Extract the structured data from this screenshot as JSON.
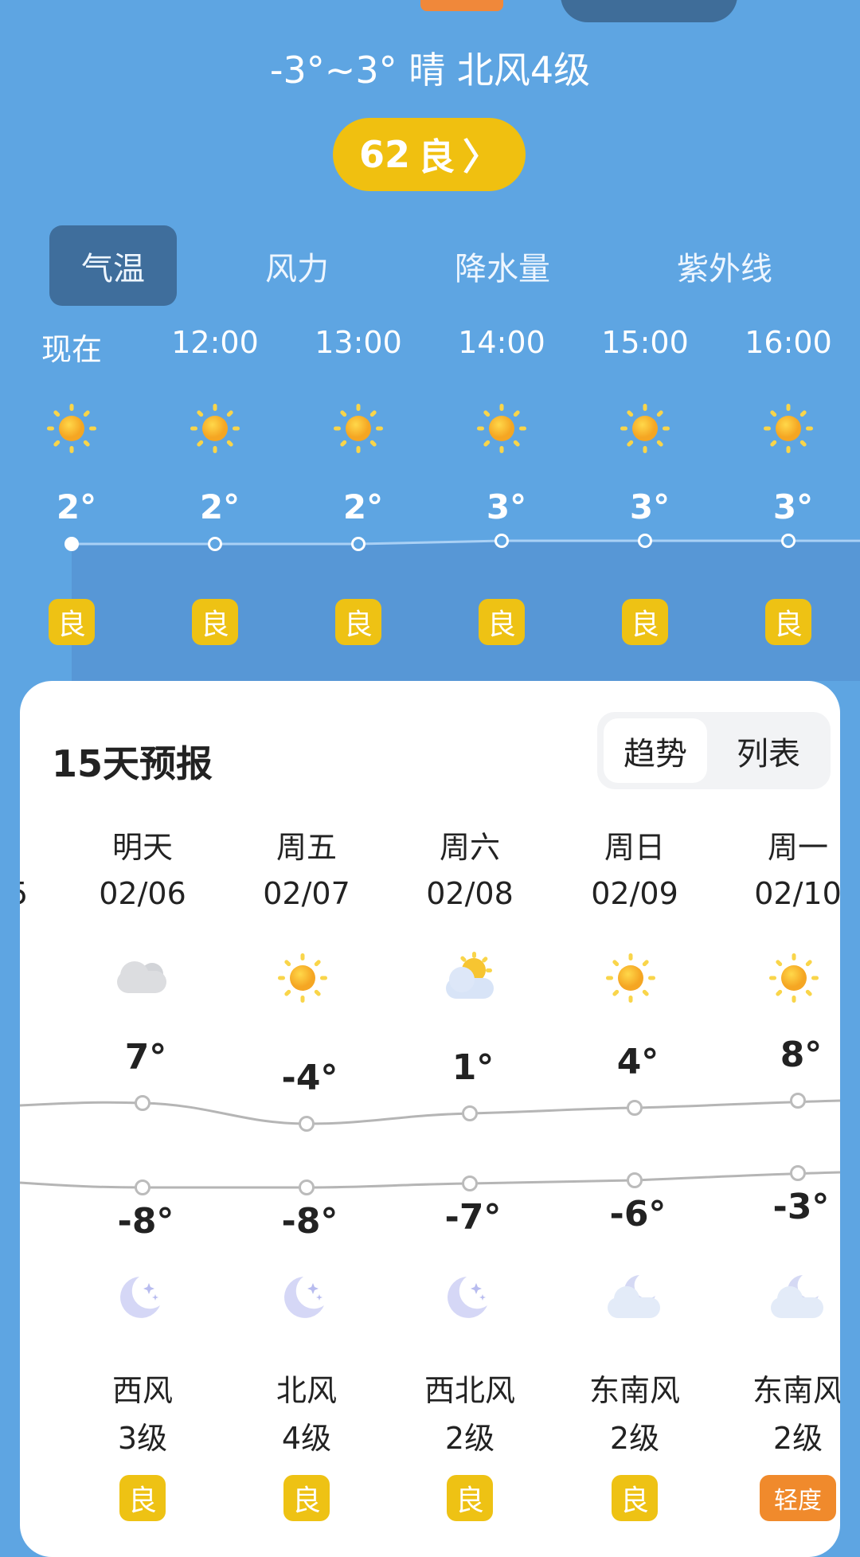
{
  "summary": "-3°~3° 晴 北风4级",
  "aqi": {
    "value": "62",
    "label": "良",
    "arrow": "〉",
    "color": "#f0c010"
  },
  "tabs": [
    {
      "label": "气温",
      "active": true
    },
    {
      "label": "风力"
    },
    {
      "label": "降水量"
    },
    {
      "label": "紫外线"
    }
  ],
  "hourly": [
    {
      "time": "现在",
      "icon": "sun-icon",
      "temp": "2°",
      "aqi": "良"
    },
    {
      "time": "12:00",
      "icon": "sun-icon",
      "temp": "2°",
      "aqi": "良"
    },
    {
      "time": "13:00",
      "icon": "sun-icon",
      "temp": "2°",
      "aqi": "良"
    },
    {
      "time": "14:00",
      "icon": "sun-icon",
      "temp": "3°",
      "aqi": "良"
    },
    {
      "time": "15:00",
      "icon": "sun-icon",
      "temp": "3°",
      "aqi": "良"
    },
    {
      "time": "16:00",
      "icon": "sun-icon",
      "temp": "3°",
      "aqi": "良"
    }
  ],
  "forecast": {
    "title": "15天预报",
    "toggle": {
      "trend": "趋势",
      "list": "列表",
      "active": "trend"
    },
    "partial_prev_date": "5",
    "days": [
      {
        "name": "明天",
        "date": "02/06",
        "icon": "cloudy-icon",
        "high": "7°",
        "low": "-8°",
        "night_icon": "moon-stars-icon",
        "wind_dir": "西风",
        "wind_level": "3级",
        "aqi": "良"
      },
      {
        "name": "周五",
        "date": "02/07",
        "icon": "sun-icon",
        "high": "-4°",
        "low": "-8°",
        "night_icon": "moon-stars-icon",
        "wind_dir": "北风",
        "wind_level": "4级",
        "aqi": "良"
      },
      {
        "name": "周六",
        "date": "02/08",
        "icon": "partly-cloudy-icon",
        "high": "1°",
        "low": "-7°",
        "night_icon": "moon-stars-icon",
        "wind_dir": "西北风",
        "wind_level": "2级",
        "aqi": "良"
      },
      {
        "name": "周日",
        "date": "02/09",
        "icon": "sun-icon",
        "high": "4°",
        "low": "-6°",
        "night_icon": "moon-cloud-icon",
        "wind_dir": "东南风",
        "wind_level": "2级",
        "aqi": "良"
      },
      {
        "name": "周一",
        "date": "02/10",
        "icon": "sun-icon",
        "high": "8°",
        "low": "-3°",
        "night_icon": "moon-cloud-icon",
        "wind_dir": "东南风",
        "wind_level": "2级",
        "aqi": "轻度"
      }
    ]
  },
  "colors": {
    "background": "#5ea5e2",
    "badge_good": "#eec214",
    "badge_light": "#f08a2c",
    "active_tab": "#3f6e9c"
  }
}
